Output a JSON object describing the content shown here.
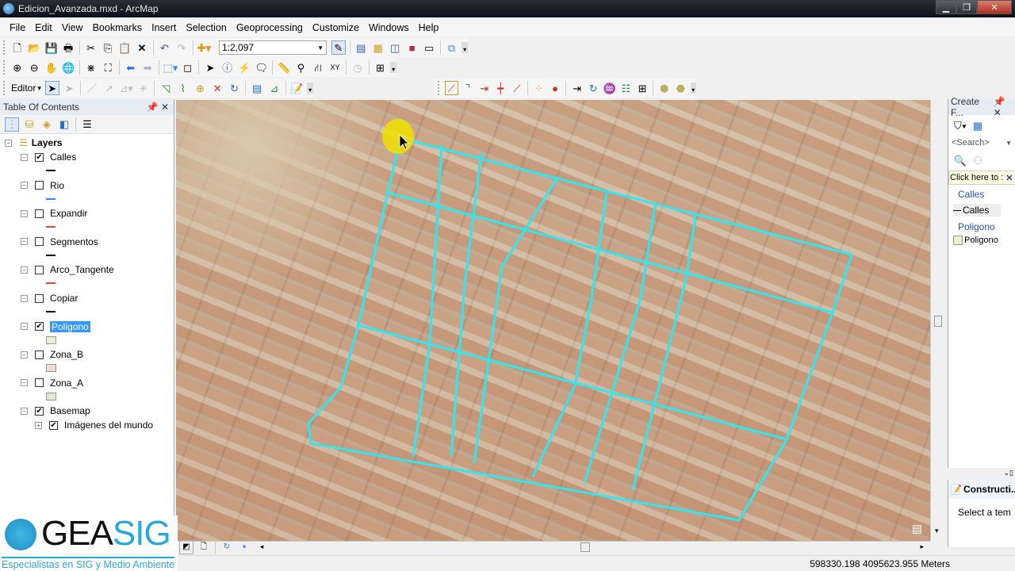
{
  "window": {
    "title": "Edicion_Avanzada.mxd - ArcMap",
    "controls": [
      "minimize",
      "restore",
      "close"
    ]
  },
  "menu": [
    "File",
    "Edit",
    "View",
    "Bookmarks",
    "Insert",
    "Selection",
    "Geoprocessing",
    "Customize",
    "Windows",
    "Help"
  ],
  "standard_toolbar": {
    "scale": "1:2,097",
    "icons": [
      "new-icon",
      "open-icon",
      "save-icon",
      "print-icon",
      "cut-icon",
      "copy-icon",
      "paste-icon",
      "delete-icon",
      "undo-icon",
      "redo-icon",
      "add-data-icon"
    ],
    "right_icons": [
      "editor-toolbar-icon",
      "toc-window-icon",
      "catalog-icon",
      "search-icon",
      "arctoolbox-icon",
      "python-icon",
      "modelbuilder-icon"
    ]
  },
  "tools_toolbar": {
    "icons": [
      "zoom-in-icon",
      "zoom-out-icon",
      "pan-icon",
      "full-extent-icon",
      "fixed-zoom-in-icon",
      "fixed-zoom-out-icon",
      "back-icon",
      "forward-icon",
      "select-features-icon",
      "clear-selection-icon",
      "select-elements-icon",
      "identify-icon",
      "hyperlink-icon",
      "html-popup-icon",
      "measure-icon",
      "find-icon",
      "find-route-icon",
      "goto-xy-icon",
      "time-slider-icon",
      "magnifier-icon"
    ]
  },
  "editor_toolbar": {
    "label": "Editor",
    "dropdown": "▾"
  },
  "advanced_editing_icons": [
    "copy-parallel-icon",
    "fillet-icon",
    "extend-icon",
    "trim-icon",
    "line-intersection-icon",
    "explode-icon",
    "generalize-icon",
    "align-edge-icon",
    "rotate-icon",
    "smooth-icon",
    "construct-features-icon",
    "split-icon",
    "buffer-icon",
    "construct-polygons-icon"
  ],
  "toc": {
    "title": "Table Of Contents",
    "root": "Layers",
    "layers": [
      {
        "name": "Calles",
        "checked": true,
        "symbol": "line",
        "color": "#000000"
      },
      {
        "name": "Rio",
        "checked": false,
        "symbol": "line",
        "color": "#3a8ee6"
      },
      {
        "name": "Expandir",
        "checked": false,
        "symbol": "line",
        "color": "#e04a3a"
      },
      {
        "name": "Segmentos",
        "checked": false,
        "symbol": "line",
        "color": "#000000"
      },
      {
        "name": "Arco_Tangente",
        "checked": false,
        "symbol": "line",
        "color": "#e04a3a"
      },
      {
        "name": "Copiar",
        "checked": false,
        "symbol": "line",
        "color": "#000000"
      },
      {
        "name": "Poligono",
        "checked": true,
        "symbol": "fill",
        "color": "#e8f0d0",
        "selected": true
      },
      {
        "name": "Zona_B",
        "checked": false,
        "symbol": "fill",
        "color": "#e8e0c8"
      },
      {
        "name": "Zona_A",
        "checked": false,
        "symbol": "fill",
        "color": "#dcebd0"
      },
      {
        "name": "Basemap",
        "checked": true,
        "symbol": "none"
      }
    ],
    "sublayer": {
      "name": "Imágenes del mundo",
      "checked": true
    }
  },
  "create_features": {
    "title": "Create F...",
    "search_placeholder": "<Search>",
    "tip": "Click here to :",
    "groups": [
      {
        "header": "Calles",
        "template": "Calles"
      },
      {
        "header": "Poligono",
        "template": "Poligono"
      }
    ]
  },
  "construction": {
    "title": "Constructi...",
    "message": "Select a tem"
  },
  "status": {
    "coordinates": "598330.198  4095623.955 Meters"
  },
  "logo": {
    "brand_dark": "GEA",
    "brand_light": "SIG",
    "tagline": "Especialistas en SIG y Medio Ambiente",
    "accent": "#29a9d8"
  },
  "map": {
    "street_color": "#33e5ee",
    "cursor_highlight": "#f0e000"
  }
}
